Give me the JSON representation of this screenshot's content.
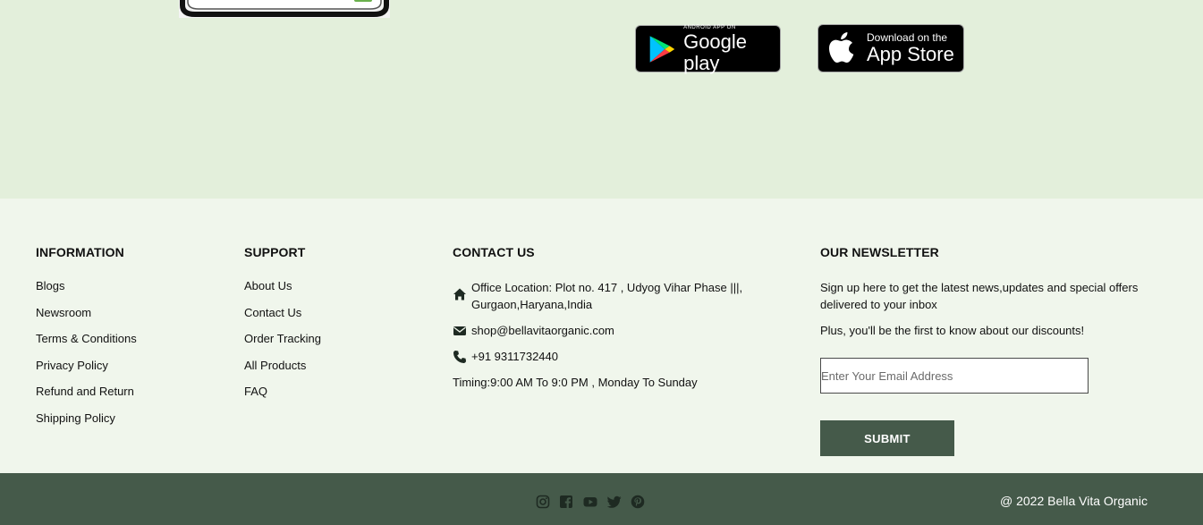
{
  "app_badges": {
    "google": {
      "small": "ANDROID APP ON",
      "big": "Google play"
    },
    "apple": {
      "small": "Download on the",
      "big": "App Store"
    }
  },
  "information": {
    "heading": "INFORMATION",
    "items": [
      "Blogs",
      "Newsroom",
      "Terms & Conditions",
      "Privacy Policy",
      "Refund and Return",
      "Shipping Policy"
    ]
  },
  "support": {
    "heading": "SUPPORT",
    "items": [
      "About Us",
      "Contact Us",
      "Order Tracking",
      "All Products",
      "FAQ"
    ]
  },
  "contact": {
    "heading": "CONTACT US",
    "address": "Office Location: Plot no. 417 , Udyog Vihar Phase |||, Gurgaon,Haryana,India",
    "email": "shop@bellavitaorganic.com",
    "phone": "+91 9311732440",
    "timing": "Timing:9:00 AM To 9:0 PM , Monday To Sunday"
  },
  "newsletter": {
    "heading": "OUR NEWSLETTER",
    "text1": "Sign up here to get the latest news,updates and special offers delivered to your inbox",
    "text2": "Plus, you'll be the first to know about our discounts!",
    "email_placeholder": "Enter Your Email Address",
    "email_value": "",
    "submit_label": "SUBMIT"
  },
  "socials": [
    "instagram-icon",
    "facebook-icon",
    "youtube-icon",
    "twitter-icon",
    "pinterest-icon"
  ],
  "copyright": "@ 2022 Bella Vita Organic",
  "colors": {
    "app_band_bg": "#e3efdb",
    "footer_bg": "#f0f6ec",
    "bottom_bar_bg": "#455a4a",
    "button_bg": "#455a4a",
    "icon_color": "#1e2a22"
  }
}
